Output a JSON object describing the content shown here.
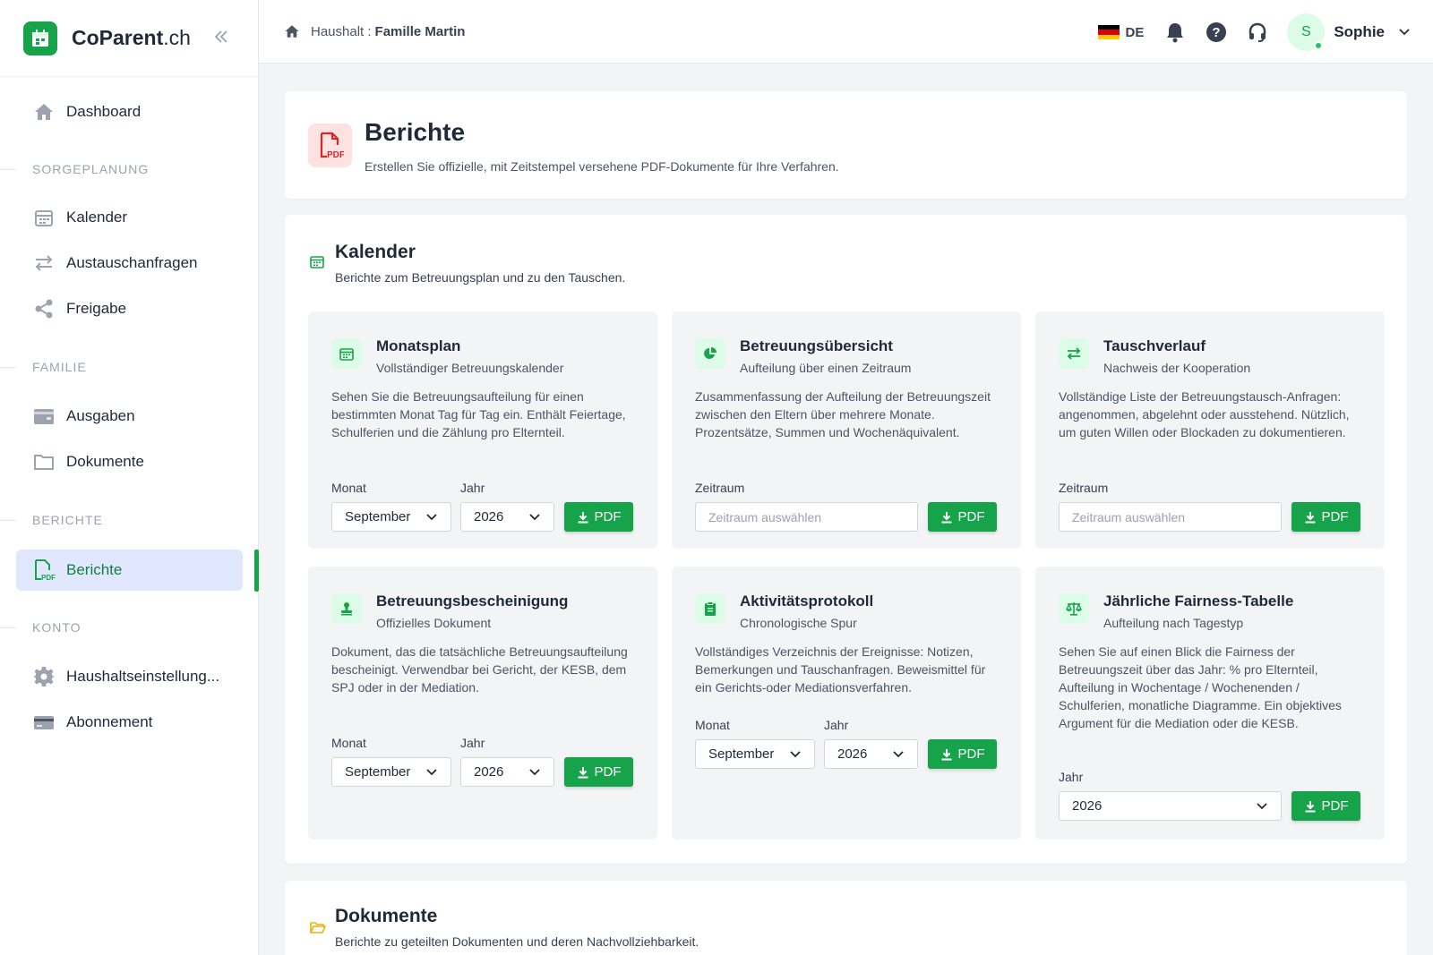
{
  "app": {
    "brand_main": "CoParent",
    "brand_tld": ".ch"
  },
  "sidebar": {
    "dashboard": "Dashboard",
    "sections": {
      "sorgeplanung": "SORGEPLANUNG",
      "familie": "FAMILIE",
      "berichte": "BERICHTE",
      "konto": "KONTO"
    },
    "items": {
      "kalender": "Kalender",
      "austausch": "Austauschanfragen",
      "freigabe": "Freigabe",
      "ausgaben": "Ausgaben",
      "dokumente": "Dokumente",
      "berichte": "Berichte",
      "haushalt": "Haushaltseinstellung...",
      "abonnement": "Abonnement"
    }
  },
  "topbar": {
    "crumb_prefix": "Haushalt :",
    "crumb_value": "Famille Martin",
    "lang": "DE",
    "avatar_initial": "S",
    "user_name": "Sophie"
  },
  "page": {
    "title": "Berichte",
    "subtitle": "Erstellen Sie offizielle, mit Zeitstempel versehene PDF-Dokumente für Ihre Verfahren."
  },
  "kalender_section": {
    "title": "Kalender",
    "subtitle": "Berichte zum Betreuungsplan und zu den Tauschen."
  },
  "reports": {
    "monatsplan": {
      "title": "Monatsplan",
      "subtitle": "Vollständiger Betreuungskalender",
      "desc": "Sehen Sie die Betreuungsaufteilung für einen bestimmten Monat Tag für Tag ein. Enthält Feiertage, Schulferien und die Zählung pro Elternteil.",
      "month_label": "Monat",
      "month_value": "September",
      "year_label": "Jahr",
      "year_value": "2026",
      "button": "PDF"
    },
    "uebersicht": {
      "title": "Betreuungsübersicht",
      "subtitle": "Aufteilung über einen Zeitraum",
      "desc": "Zusammenfassung der Aufteilung der Betreuungszeit zwischen den Eltern über mehrere Monate. Prozentsätze, Summen und Wochenäquivalent.",
      "range_label": "Zeitraum",
      "range_placeholder": "Zeitraum auswählen",
      "button": "PDF"
    },
    "tausch": {
      "title": "Tauschverlauf",
      "subtitle": "Nachweis der Kooperation",
      "desc": "Vollständige Liste der Betreuungstausch-Anfragen: angenommen, abgelehnt oder ausstehend. Nützlich, um guten Willen oder Blockaden zu dokumentieren.",
      "range_label": "Zeitraum",
      "range_placeholder": "Zeitraum auswählen",
      "button": "PDF"
    },
    "bescheinigung": {
      "title": "Betreuungsbescheinigung",
      "subtitle": "Offizielles Dokument",
      "desc": "Dokument, das die tatsächliche Betreuungsaufteilung bescheinigt. Verwendbar bei Gericht, der KESB, dem SPJ oder in der Mediation.",
      "month_label": "Monat",
      "month_value": "September",
      "year_label": "Jahr",
      "year_value": "2026",
      "button": "PDF"
    },
    "aktivitaet": {
      "title": "Aktivitätsprotokoll",
      "subtitle": "Chronologische Spur",
      "desc": "Vollständiges Verzeichnis der Ereignisse: Notizen, Bemerkungen und Tauschanfragen. Beweismittel für ein Gerichts-oder Mediationsverfahren.",
      "month_label": "Monat",
      "month_value": "September",
      "year_label": "Jahr",
      "year_value": "2026",
      "button": "PDF"
    },
    "fairness": {
      "title": "Jährliche Fairness-Tabelle",
      "subtitle": "Aufteilung nach Tagestyp",
      "desc": "Sehen Sie auf einen Blick die Fairness der Betreuungszeit über das Jahr: % pro Elternteil, Aufteilung in Wochentage / Wochenenden / Schulferien, monatliche Diagramme. Ein objektives Argument für die Mediation oder die KESB.",
      "year_label": "Jahr",
      "year_value": "2026",
      "button": "PDF"
    }
  },
  "dokumente_section": {
    "title": "Dokumente",
    "subtitle": "Berichte zu geteilten Dokumenten und deren Nachvollziehbarkeit."
  },
  "colors": {
    "accent": "#16a34a",
    "active_bg": "#e0e7ff",
    "pdf_red": "#dc2626",
    "folder": "#eab308"
  }
}
